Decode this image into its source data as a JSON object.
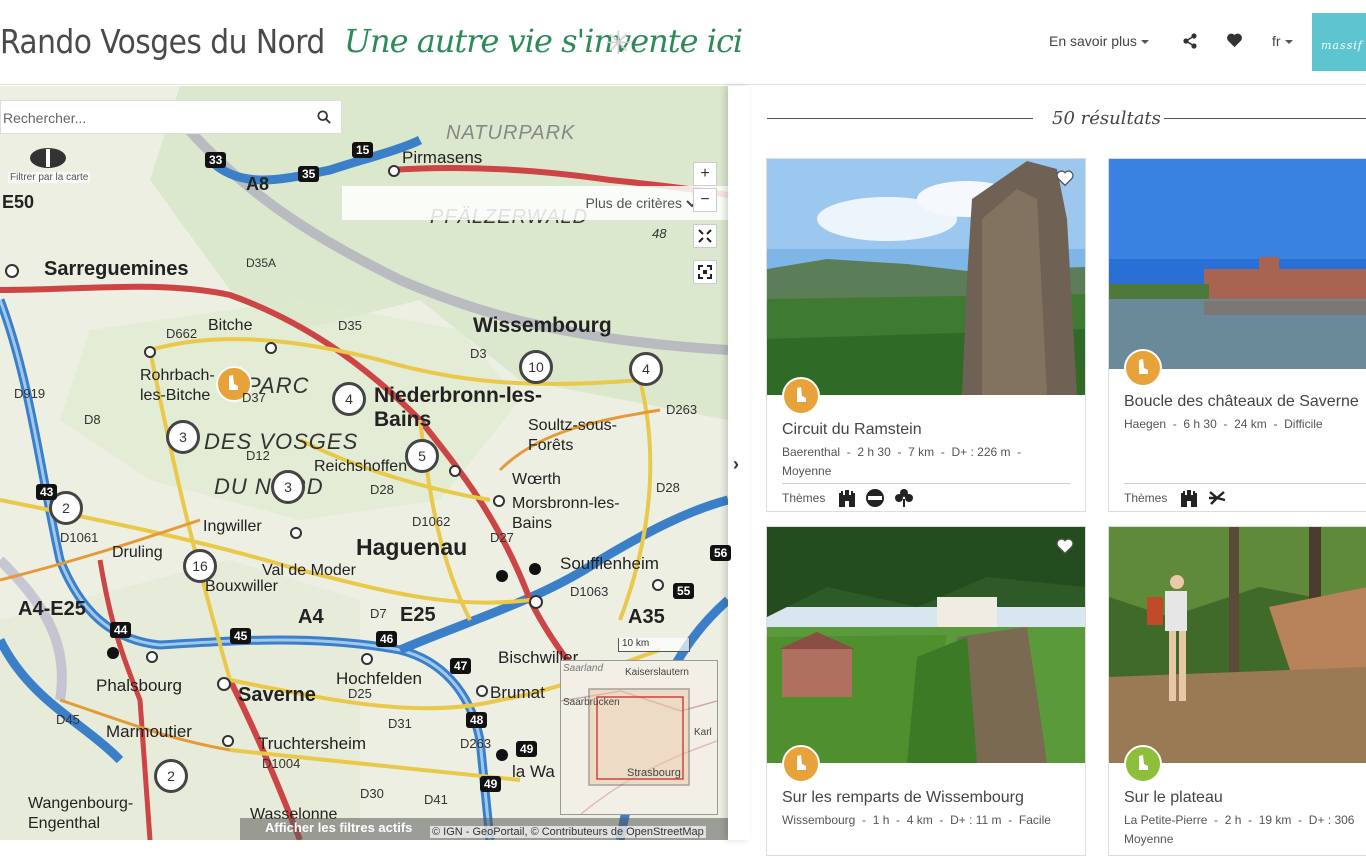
{
  "header": {
    "site_title": "Rando Vosges du Nord",
    "tagline": "Une autre vie s'invente ici",
    "nav_more": "En savoir plus",
    "language": "fr",
    "share_icon": "share-icon",
    "favorites_icon": "heart-icon",
    "brand_logo_text": "massif"
  },
  "map": {
    "search_placeholder": "Rechercher...",
    "more_criteria": "Plus de critères",
    "filter_by_map": "Filtrer par la carte",
    "zoom_in": "+",
    "zoom_out": "−",
    "show_filters": "Afficher les filtres actifs",
    "attribution": "© IGN - GeoPortail, © Contributeurs de OpenStreetMap",
    "scale_label": "10 km",
    "place_labels": [
      "Sarreguemines",
      "Bitche",
      "Pirmasens",
      "PFÄLZERWALD",
      "NATURPARK",
      "Wissembourg",
      "Niederbronn-les-Bains",
      "Rohrbach-les-Bitche",
      "PARC",
      "DES VOSGES",
      "DU NORD",
      "Reichshoffen",
      "Soultz-sous-Forêts",
      "Wœrth",
      "Morsbronn-les-Bains",
      "Haguenau",
      "Soufflenheim",
      "Ingwiller",
      "Druling",
      "Val de Moder",
      "Bouxwiller",
      "Phalsbourg",
      "Saverne",
      "Hochfelden",
      "Brumat",
      "Bischwiller",
      "Marmoutier",
      "Truchtersheim",
      "Wangenbourg-Engenthal",
      "Wasselonne",
      "la Wa"
    ],
    "road_labels": [
      "A8",
      "E50",
      "D35A",
      "D662",
      "D35",
      "D3",
      "D919",
      "D8",
      "D37",
      "D12",
      "D28",
      "D1062",
      "D27",
      "D1063",
      "D28",
      "A4-E25",
      "A4",
      "E25",
      "D7",
      "D1061",
      "D45",
      "D25",
      "D31",
      "D263",
      "D1004",
      "D30",
      "D41",
      "A35",
      "D263"
    ],
    "road_numbers": [
      "33",
      "35",
      "15",
      "48",
      "46",
      "45",
      "44",
      "47",
      "48",
      "49",
      "49",
      "55",
      "56",
      "43"
    ],
    "clusters": [
      {
        "count": "10"
      },
      {
        "count": "4"
      },
      {
        "count": "4"
      },
      {
        "count": "3"
      },
      {
        "count": "3"
      },
      {
        "count": "5"
      },
      {
        "count": "2"
      },
      {
        "count": "16"
      },
      {
        "count": "2"
      }
    ],
    "minimap_labels": [
      "Saarland",
      "Kaiserslautern",
      "Saarbrücken",
      "Karl",
      "Strasbourg"
    ]
  },
  "results": {
    "count_label": "50 résultats",
    "themes_label": "Thèmes",
    "cards": [
      {
        "title": "Circuit du Ramstein",
        "location": "Baerenthal",
        "duration": "2 h 30",
        "distance": "7 km",
        "elevation": "D+ : 226 m",
        "difficulty": "Moyenne",
        "theme_icons": [
          "castle-icon",
          "heritage-icon",
          "clover-icon"
        ]
      },
      {
        "title": "Boucle des châteaux de Saverne",
        "location": "Haegen",
        "duration": "6 h 30",
        "distance": "24 km",
        "elevation": "",
        "difficulty": "Difficile",
        "theme_icons": [
          "castle-icon",
          "flora-icon"
        ]
      },
      {
        "title": "Sur les remparts de Wissembourg",
        "location": "Wissembourg",
        "duration": "1 h",
        "distance": "4 km",
        "elevation": "D+ : 11 m",
        "difficulty": "Facile",
        "theme_icons": []
      },
      {
        "title": "Sur le plateau",
        "location": "La Petite-Pierre",
        "duration": "2 h",
        "distance": "19 km",
        "elevation": "D+ : 306",
        "difficulty": "Moyenne",
        "theme_icons": []
      }
    ]
  },
  "colors": {
    "accent": "#2e8b57",
    "trek_badge": "#e8a23a",
    "trek_badge_green": "#8dbf3a",
    "brand": "#5cc5d0"
  }
}
